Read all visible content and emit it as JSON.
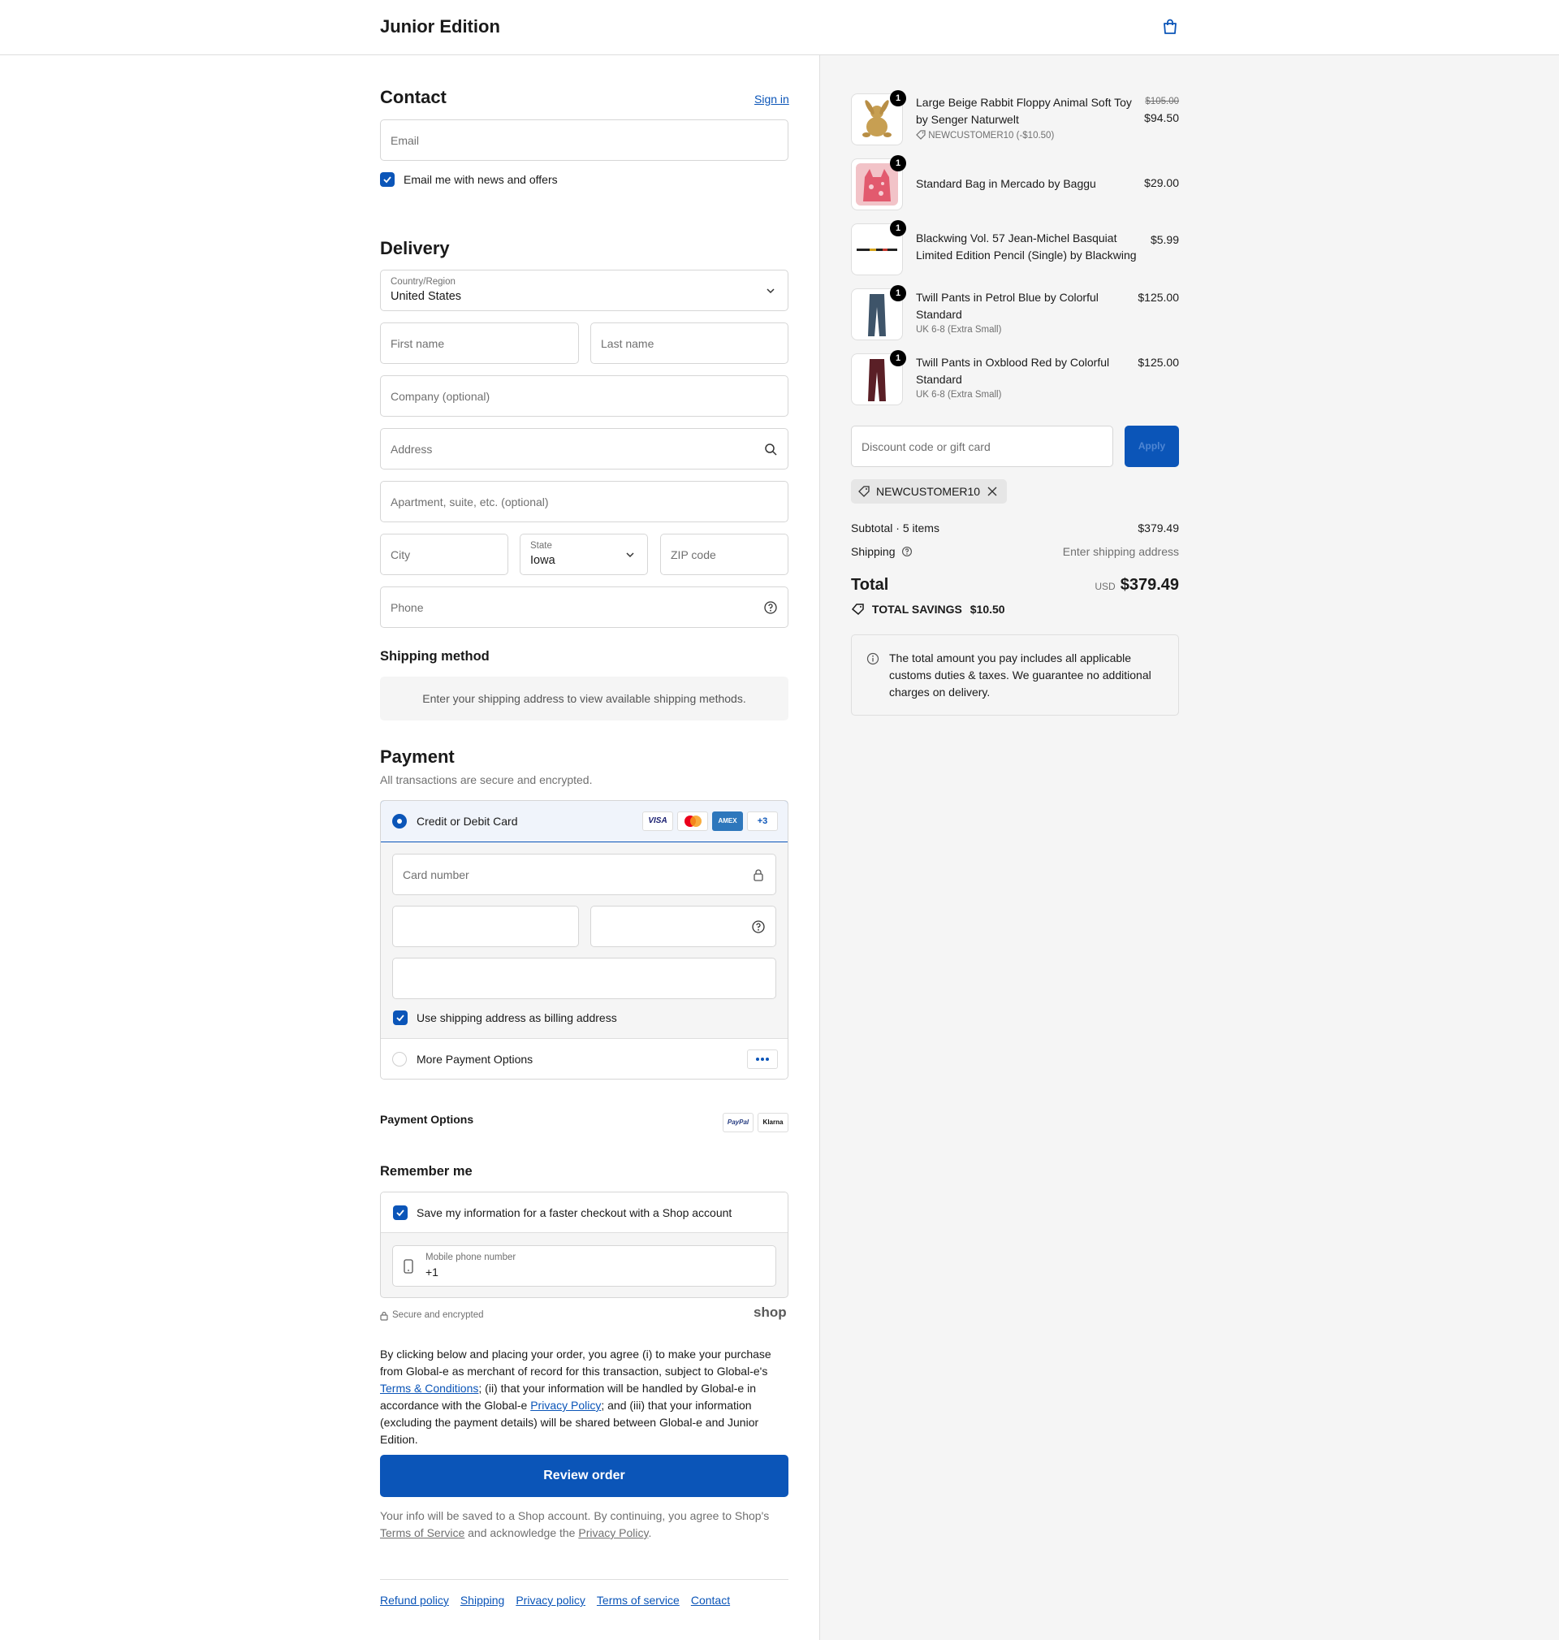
{
  "header": {
    "brand": "Junior Edition"
  },
  "contact": {
    "title": "Contact",
    "sign_in": "Sign in",
    "email_placeholder": "Email",
    "newsletter_label": "Email me with news and offers"
  },
  "delivery": {
    "title": "Delivery",
    "country_label": "Country/Region",
    "country_value": "United States",
    "first_name": "First name",
    "last_name": "Last name",
    "company": "Company (optional)",
    "address": "Address",
    "apartment": "Apartment, suite, etc. (optional)",
    "city": "City",
    "state_label": "State",
    "state_value": "Iowa",
    "zip": "ZIP code",
    "phone": "Phone"
  },
  "shipping_method": {
    "title": "Shipping method",
    "message": "Enter your shipping address to view available shipping methods."
  },
  "payment": {
    "title": "Payment",
    "subtitle": "All transactions are secure and encrypted.",
    "card_option": "Credit or Debit Card",
    "card_brands": [
      "VISA",
      "AMEX",
      "+3"
    ],
    "card_number": "Card number",
    "billing_label": "Use shipping address as billing address",
    "more_options": "More Payment Options"
  },
  "payment_options": {
    "title": "Payment Options",
    "badges": [
      "PayPal",
      "Klarna"
    ]
  },
  "remember": {
    "title": "Remember me",
    "save_label": "Save my information for a faster checkout with a Shop account",
    "mobile_label": "Mobile phone number",
    "mobile_value": "+1",
    "secure": "Secure and encrypted",
    "shop_logo": "shop"
  },
  "legal": {
    "p1": "By clicking below and placing your order, you agree (i) to make your purchase from Global-e as merchant of record for this transaction, subject to Global-e's ",
    "terms_link": "Terms & Conditions",
    "p2": "; (ii) that your information will be handled by Global-e in accordance with the Global-e ",
    "privacy_link": "Privacy Policy",
    "p3": "; and (iii) that your information (excluding the payment details) will be shared between Global-e and Junior Edition."
  },
  "review_button": "Review order",
  "shop_notice": {
    "p1": "Your info will be saved to a Shop account. By continuing, you agree to Shop's ",
    "tos": "Terms of Service",
    "p2": " and acknowledge the ",
    "privacy": "Privacy Policy",
    "p3": "."
  },
  "footer_links": [
    "Refund policy",
    "Shipping",
    "Privacy policy",
    "Terms of service",
    "Contact"
  ],
  "summary": {
    "items": [
      {
        "name_l1": "Large Beige Rabbit Floppy Animal Soft Toy",
        "name_l2": "by Senger Naturwelt",
        "qty": "1",
        "orig_price": "$105.00",
        "price": "$94.50",
        "discount": "NEWCUSTOMER10 (-$10.50)"
      },
      {
        "name_l1": "Standard Bag in Mercado by Baggu",
        "qty": "1",
        "price": "$29.00"
      },
      {
        "name_l1": "Blackwing Vol. 57 Jean-Michel Basquiat",
        "name_l2": "Limited Edition Pencil (Single) by Blackwing",
        "qty": "1",
        "price": "$5.99"
      },
      {
        "name_l1": "Twill Pants in Petrol Blue by Colorful",
        "name_l2": "Standard",
        "variant": "UK 6-8 (Extra Small)",
        "qty": "1",
        "price": "$125.00"
      },
      {
        "name_l1": "Twill Pants in Oxblood Red by Colorful",
        "name_l2": "Standard",
        "variant": "UK 6-8 (Extra Small)",
        "qty": "1",
        "price": "$125.00"
      }
    ],
    "discount_placeholder": "Discount code or gift card",
    "apply": "Apply",
    "applied_code": "NEWCUSTOMER10",
    "subtotal_label": "Subtotal · 5 items",
    "subtotal_value": "$379.49",
    "shipping_label": "Shipping",
    "shipping_value": "Enter shipping address",
    "total_label": "Total",
    "total_currency": "USD",
    "total_value": "$379.49",
    "savings_label": "TOTAL SAVINGS",
    "savings_value": "$10.50",
    "duty_notice": "The total amount you pay includes all applicable customs duties & taxes. We guarantee no additional charges on delivery."
  },
  "colors": {
    "accent": "#0b55b8",
    "summary_bg": "#f5f5f5"
  }
}
